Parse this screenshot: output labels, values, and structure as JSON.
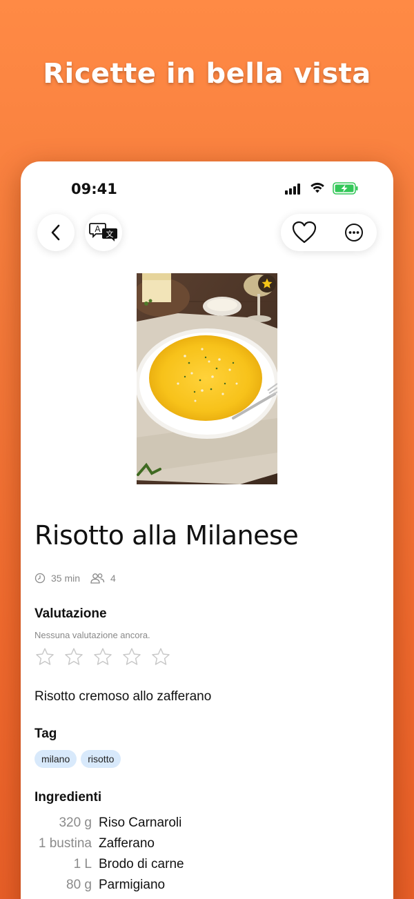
{
  "headline": "Ricette in bella vista",
  "status_bar": {
    "time": "09:41"
  },
  "toolbar": {
    "back_icon": "chevron-left-icon",
    "translate_icon": "translate-icon",
    "favorite_icon": "heart-icon",
    "more_icon": "ellipsis-circle-icon"
  },
  "recipe": {
    "title": "Risotto alla Milanese",
    "time": "35 min",
    "servings": "4",
    "description": "Risotto cremoso allo zafferano"
  },
  "rating": {
    "heading": "Valutazione",
    "note": "Nessuna valutazione ancora.",
    "stars_total": 5,
    "stars_filled": 0
  },
  "tags": {
    "heading": "Tag",
    "items": [
      "milano",
      "risotto"
    ]
  },
  "ingredients": {
    "heading": "Ingredienti",
    "items": [
      {
        "qty": "320 g",
        "name": "Riso Carnaroli"
      },
      {
        "qty": "1 bustina",
        "name": "Zafferano"
      },
      {
        "qty": "1 L",
        "name": "Brodo di carne"
      },
      {
        "qty": "80 g",
        "name": "Parmigiano"
      }
    ]
  },
  "colors": {
    "background": "#f47a3a",
    "tag_bg": "#d8e9fb",
    "battery": "#34c759",
    "saffron": "#f5c518"
  }
}
